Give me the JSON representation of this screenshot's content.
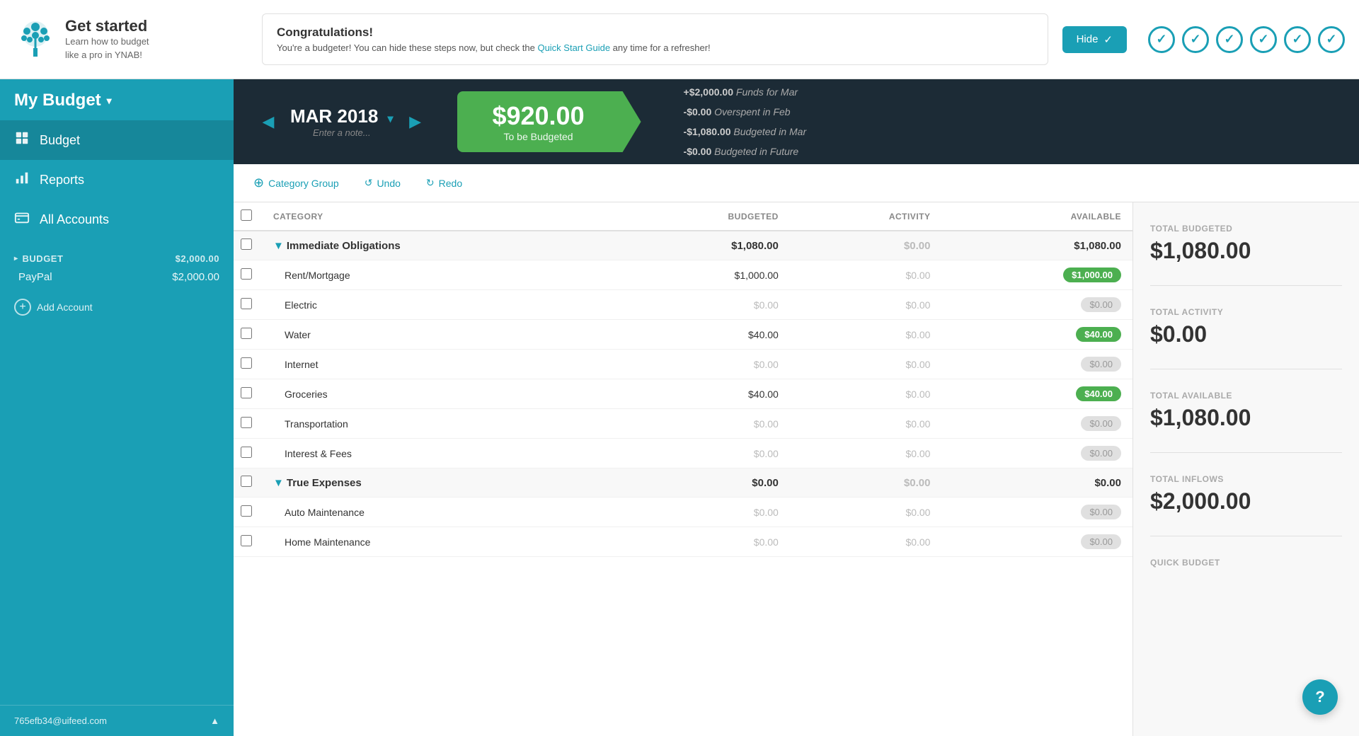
{
  "banner": {
    "logo_alt": "YNAB Logo",
    "get_started": "Get started",
    "tagline1": "Learn how to budget",
    "tagline2": "like a pro in YNAB!",
    "congrats_title": "Congratulations!",
    "congrats_body": "You're a budgeter! You can hide these steps now, but check the ",
    "congrats_link": "Quick Start Guide",
    "congrats_body2": " any time for a refresher!",
    "hide_btn": "Hide"
  },
  "sidebar": {
    "my_budget": "My Budget",
    "nav_budget": "Budget",
    "nav_reports": "Reports",
    "nav_all_accounts": "All Accounts",
    "budget_section": "BUDGET",
    "budget_amount": "$2,000.00",
    "account_name": "PayPal",
    "account_amount": "$2,000.00",
    "add_account": "Add Account",
    "user_email": "765efb34@uifeed.com"
  },
  "budget_bar": {
    "month": "MAR 2018",
    "note_placeholder": "Enter a note...",
    "to_budget_amount": "$920.00",
    "to_budget_label": "To be Budgeted",
    "funds_for_mar": "+$2,000.00",
    "funds_label": "Funds for Mar",
    "overspent_feb": "-$0.00",
    "overspent_label": "Overspent in Feb",
    "budgeted_mar": "-$1,080.00",
    "budgeted_mar_label": "Budgeted in Mar",
    "budgeted_future": "-$0.00",
    "budgeted_future_label": "Budgeted in Future"
  },
  "toolbar": {
    "category_group": "Category Group",
    "undo": "Undo",
    "redo": "Redo"
  },
  "table": {
    "col_category": "CATEGORY",
    "col_budgeted": "BUDGETED",
    "col_activity": "ACTIVITY",
    "col_available": "AVAILABLE",
    "rows": [
      {
        "type": "group",
        "name": "Immediate Obligations",
        "budgeted": "$1,080.00",
        "activity": "$0.00",
        "available": "$1,080.00",
        "badge_type": "none"
      },
      {
        "type": "item",
        "name": "Rent/Mortgage",
        "budgeted": "$1,000.00",
        "activity": "$0.00",
        "available": "$1,000.00",
        "badge_type": "green"
      },
      {
        "type": "item",
        "name": "Electric",
        "budgeted": "$0.00",
        "activity": "$0.00",
        "available": "$0.00",
        "badge_type": "gray"
      },
      {
        "type": "item",
        "name": "Water",
        "budgeted": "$40.00",
        "activity": "$0.00",
        "available": "$40.00",
        "badge_type": "green"
      },
      {
        "type": "item",
        "name": "Internet",
        "budgeted": "$0.00",
        "activity": "$0.00",
        "available": "$0.00",
        "badge_type": "gray"
      },
      {
        "type": "item",
        "name": "Groceries",
        "budgeted": "$40.00",
        "activity": "$0.00",
        "available": "$40.00",
        "badge_type": "green"
      },
      {
        "type": "item",
        "name": "Transportation",
        "budgeted": "$0.00",
        "activity": "$0.00",
        "available": "$0.00",
        "badge_type": "gray"
      },
      {
        "type": "item",
        "name": "Interest & Fees",
        "budgeted": "$0.00",
        "activity": "$0.00",
        "available": "$0.00",
        "badge_type": "gray"
      },
      {
        "type": "group",
        "name": "True Expenses",
        "budgeted": "$0.00",
        "activity": "$0.00",
        "available": "$0.00",
        "badge_type": "none"
      },
      {
        "type": "item",
        "name": "Auto Maintenance",
        "budgeted": "$0.00",
        "activity": "$0.00",
        "available": "$0.00",
        "badge_type": "gray"
      },
      {
        "type": "item",
        "name": "Home Maintenance",
        "budgeted": "$0.00",
        "activity": "$0.00",
        "available": "$0.00",
        "badge_type": "gray"
      }
    ]
  },
  "stats": {
    "total_budgeted_label": "TOTAL BUDGETED",
    "total_budgeted_value": "$1,080.00",
    "total_activity_label": "TOTAL ACTIVITY",
    "total_activity_value": "$0.00",
    "total_available_label": "TOTAL AVAILABLE",
    "total_available_value": "$1,080.00",
    "total_inflows_label": "TOTAL INFLOWS",
    "total_inflows_value": "$2,000.00",
    "quick_budget_label": "QUICK BUDGET"
  },
  "help_btn": "?",
  "colors": {
    "teal": "#1a9fb5",
    "dark_header": "#1c2b36",
    "green": "#4caf50"
  }
}
